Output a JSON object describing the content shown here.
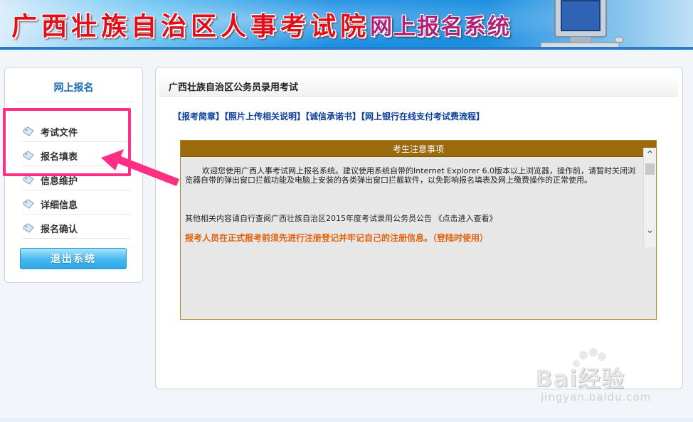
{
  "banner": {
    "title": "广西壮族自治区人事考试院",
    "subtitle": "网上报名系统"
  },
  "sidebar": {
    "heading": "网上报名",
    "items": [
      {
        "label": "考试文件"
      },
      {
        "label": "报名填表"
      },
      {
        "label": "信息维护"
      },
      {
        "label": "详细信息"
      },
      {
        "label": "报名确认"
      }
    ],
    "logout_label": "退出系统"
  },
  "main": {
    "title": "广西壮族自治区公务员录用考试",
    "links": [
      "【报考简章】",
      "【照片上传相关说明】",
      "【诚信承诺书】",
      "【网上银行在线支付考试费流程】"
    ],
    "notice": {
      "heading": "考生注意事项",
      "paragraph1": "欢迎您使用广西人事考试网上报名系统。建议使用系统自带的Internet Explorer 6.0版本以上浏览器，操作前，请暂时关闭浏览器自带的弹出窗口拦截功能及电脑上安装的各类弹出窗口拦截软件，以免影响报名填表及网上缴费操作的正常使用。",
      "paragraph2": "其他相关内容请自行查阅广西壮族自治区2015年度考试录用公务员公告 《点击进入查看》",
      "paragraph3": "报考人员在正式报考前须先进行注册登记并牢记自己的注册信息。（登陆时使用）"
    }
  },
  "watermark": {
    "brand": "Bai经验",
    "url": "jingyan.baidu.com"
  },
  "colors": {
    "highlight": "#ff2f84",
    "notice_header": "#9b6a0c",
    "warning_text": "#e0620c",
    "link": "#0b3f9a"
  }
}
